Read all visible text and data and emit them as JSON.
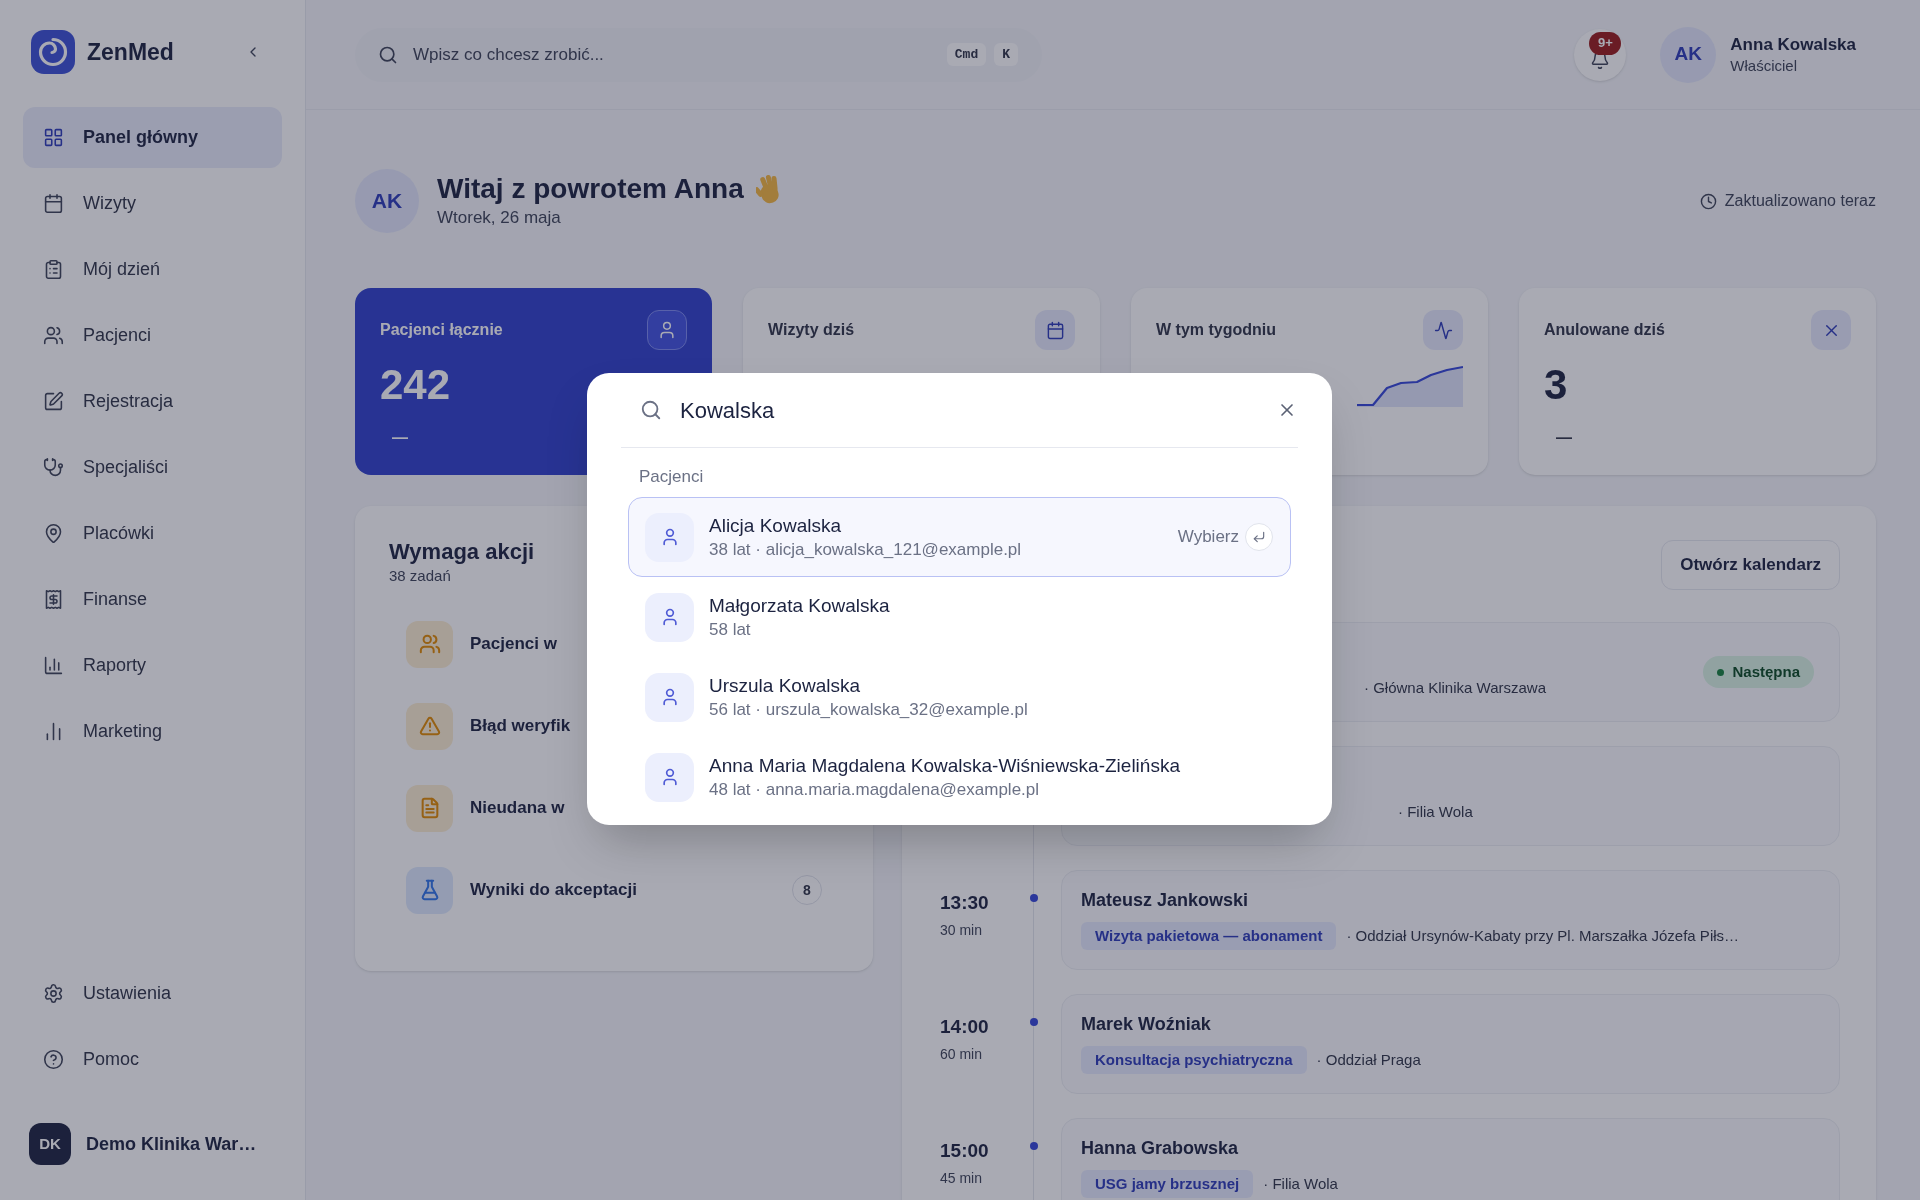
{
  "sidebar": {
    "brand": "ZenMed",
    "nav": [
      {
        "label": "Panel główny",
        "selected": true
      },
      {
        "label": "Wizyty",
        "selected": false
      },
      {
        "label": "Mój dzień",
        "selected": false
      },
      {
        "label": "Pacjenci",
        "selected": false
      },
      {
        "label": "Rejestracja",
        "selected": false
      },
      {
        "label": "Specjaliści",
        "selected": false
      },
      {
        "label": "Placówki",
        "selected": false
      },
      {
        "label": "Finanse",
        "selected": false
      },
      {
        "label": "Raporty",
        "selected": false
      },
      {
        "label": "Marketing",
        "selected": false
      }
    ],
    "footer_nav": [
      {
        "label": "Ustawienia"
      },
      {
        "label": "Pomoc"
      }
    ],
    "workspace": {
      "initials": "DK",
      "name": "Demo Klinika War…"
    }
  },
  "header": {
    "search": {
      "placeholder": "Wpisz co chcesz zrobić...",
      "shortcut": [
        "Cmd",
        "K"
      ]
    },
    "notifications": {
      "badge": "9+"
    },
    "user": {
      "initials": "AK",
      "name": "Anna Kowalska",
      "role": "Właściciel"
    }
  },
  "welcome": {
    "initials": "AK",
    "title": "Witaj z powrotem Anna",
    "date": "Wtorek, 26 maja",
    "updated": "Zaktualizowano teraz"
  },
  "stats": [
    {
      "label": "Pacjenci łącznie",
      "value": "242",
      "note": "—",
      "highlighted": true,
      "kind": "plain"
    },
    {
      "label": "Wizyty dziś",
      "highlighted": false,
      "kind": "plain"
    },
    {
      "label": "W tym tygodniu",
      "highlighted": false,
      "kind": "trend"
    },
    {
      "label": "Anulowane dziś",
      "value": "3",
      "note": "—",
      "highlighted": false,
      "kind": "plain"
    }
  ],
  "tasks": {
    "title": "Wymaga akcji",
    "count": "38 zadań",
    "items": [
      {
        "label": "Pacjenci w",
        "kind": "warning"
      },
      {
        "label": "Błąd weryfik",
        "kind": "warning"
      },
      {
        "label": "Nieudana w",
        "kind": "warning"
      },
      {
        "label": "Wyniki do akceptacji",
        "kind": "info",
        "badge": "8"
      }
    ]
  },
  "schedule": {
    "button": "Otwórz kalendarz",
    "items": [
      {
        "location": "· Główna Klinika Warszawa",
        "status": "Następna"
      },
      {
        "location": "· Filia Wola"
      },
      {
        "time": "13:30",
        "duration": "30 min",
        "patient": "Mateusz Jankowski",
        "service": "Wizyta pakietowa — abonament",
        "location": "· Oddział Ursynów-Kabaty przy Pl. Marszałka Józefa Piłs…"
      },
      {
        "time": "14:00",
        "duration": "60 min",
        "patient": "Marek Woźniak",
        "service": "Konsultacja psychiatryczna",
        "location": "· Oddział Praga"
      },
      {
        "time": "15:00",
        "duration": "45 min",
        "patient": "Hanna Grabowska",
        "service": "USG jamy brzusznej",
        "location": "· Filia Wola"
      }
    ]
  },
  "search_dialog": {
    "query": "Kowalska",
    "section": "Pacjenci",
    "action": "Wybierz",
    "results": [
      {
        "name": "Alicja Kowalska",
        "details": "38 lat · alicja_kowalska_121@example.pl",
        "selected": true
      },
      {
        "name": "Małgorzata Kowalska",
        "details": "58 lat",
        "selected": false
      },
      {
        "name": "Urszula Kowalska",
        "details": "56 lat · urszula_kowalska_32@example.pl",
        "selected": false
      },
      {
        "name": "Anna Maria Magdalena Kowalska-Wiśniewska-Zielińska",
        "details": "48 lat · anna.maria.magdalena@example.pl",
        "selected": false
      }
    ]
  }
}
